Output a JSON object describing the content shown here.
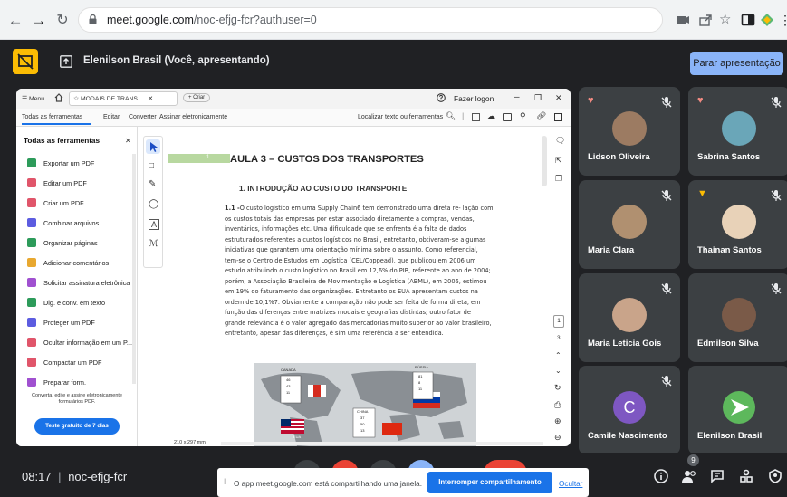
{
  "browser": {
    "url_host": "meet.google.com",
    "url_path": "/noc-efjg-fcr?authuser=0"
  },
  "meet": {
    "presenter_label": "Elenilson Brasil (Você, apresentando)",
    "stop_button": "Parar apresentação",
    "time": "08:17",
    "separator": "|",
    "meeting_code": "noc-efjg-fcr",
    "participant_count": "9",
    "share_notice": "O app meet.google.com está compartilhando uma janela.",
    "stop_sharing_button": "Interromper compartilhamento",
    "hide_link": "Ocultar",
    "colors": {
      "accent": "#8ab4f8",
      "bg": "#202124",
      "tile": "#3c4043",
      "button_blue": "#1a73e8"
    }
  },
  "acrobat": {
    "menu": "Menu",
    "tab_title": "MODAIS DE TRANS...",
    "new_tab": "Criar",
    "login": "Fazer logon",
    "toolbar_items": [
      "Todas as ferramentas",
      "Editar",
      "Converter",
      "Assinar eletronicamente"
    ],
    "search_placeholder": "Localizar texto ou ferramentas",
    "panel_title": "Todas as ferramentas",
    "tools": [
      {
        "label": "Exportar um PDF",
        "color": "#2d9b5a"
      },
      {
        "label": "Editar um PDF",
        "color": "#e0556a"
      },
      {
        "label": "Criar um PDF",
        "color": "#e0556a"
      },
      {
        "label": "Combinar arquivos",
        "color": "#5c5ce0"
      },
      {
        "label": "Organizar páginas",
        "color": "#2d9b5a"
      },
      {
        "label": "Adicionar comentários",
        "color": "#e8a830"
      },
      {
        "label": "Solicitar assinatura eletrônica",
        "color": "#a050d0"
      },
      {
        "label": "Dig. e conv. em texto",
        "color": "#2d9b5a"
      },
      {
        "label": "Proteger um PDF",
        "color": "#5c5ce0"
      },
      {
        "label": "Ocultar informação em um P...",
        "color": "#e0556a"
      },
      {
        "label": "Compactar um PDF",
        "color": "#e0556a"
      },
      {
        "label": "Preparar form.",
        "color": "#a050d0"
      }
    ],
    "promo_text_1": "Converta, edite e assine eletronicamente",
    "promo_text_2": "formulários PDF.",
    "trial_button": "Teste gratuito de 7 dias",
    "page_size": "210 x 297 mm",
    "page_number": "1",
    "page_total": "3",
    "doc": {
      "badge": "1",
      "heading": "AULA 3 – CUSTOS DOS TRANSPORTES",
      "subheading": "1.  INTRODUÇÃO AO CUSTO DO TRANSPORTE",
      "para_number": "1.1 -",
      "lines": [
        "O custo logístico em uma Supply Chain6 tem demonstrado uma direta re- lação com",
        "os custos totais das empresas por estar associado diretamente a compras, vendas,",
        "inventários, informações etc. Uma dificuldade que se enfrenta é a falta de dados",
        "estruturados referentes a custos logísticos no Brasil, entretanto, obtiveram-se algumas",
        "iniciativas que garantem uma orientação mínima sobre o assunto. Como referencial,",
        "tem-se o Centro de Estudos em Logística (CEL/Coppead), que publicou em 2006 um",
        "estudo atribuindo o custo logístico no Brasil em 12,6% do PIB, referente ao ano de 2004;",
        "porém, a Associação Brasileira de Movimentação e Logística (ABML), em 2006, estimou",
        "em 19% do faturamento das organizações. Entretanto os EUA apresentam custos na",
        "ordem de 10,1%7. Obviamente a comparação não pode ser feita de forma direta, em",
        "função das diferenças entre matrizes modais e geografias distintas; outro fator de",
        "grande relevância é o valor agregado das mercadorias muito superior ao valor brasileiro,",
        "entretanto, apesar das diferenças, é sim uma referência a ser entendida."
      ],
      "map_labels": [
        "CANADA",
        "RÚSSIA",
        "CHINA",
        "EUA"
      ],
      "map_values": {
        "canada": [
          "46",
          "43",
          "11"
        ],
        "russia": [
          "81",
          "8",
          "11"
        ],
        "china": [
          "37",
          "50",
          "13"
        ]
      }
    }
  },
  "participants": [
    {
      "name": "Lidson Oliveira",
      "muted": true,
      "reaction": "heart"
    },
    {
      "name": "Sabrina Santos",
      "muted": true,
      "reaction": "heart"
    },
    {
      "name": "Maria Clara",
      "muted": true,
      "reaction": ""
    },
    {
      "name": "Thainan Santos",
      "muted": true,
      "reaction": "thumbs-down"
    },
    {
      "name": "Maria Leticia Gois",
      "muted": true,
      "reaction": ""
    },
    {
      "name": "Edmilson Silva",
      "muted": true,
      "reaction": ""
    },
    {
      "name": "Camile Nascimento",
      "muted": true,
      "reaction": "",
      "initial": "C"
    },
    {
      "name": "Elenilson Brasil",
      "muted": false,
      "reaction": ""
    }
  ]
}
